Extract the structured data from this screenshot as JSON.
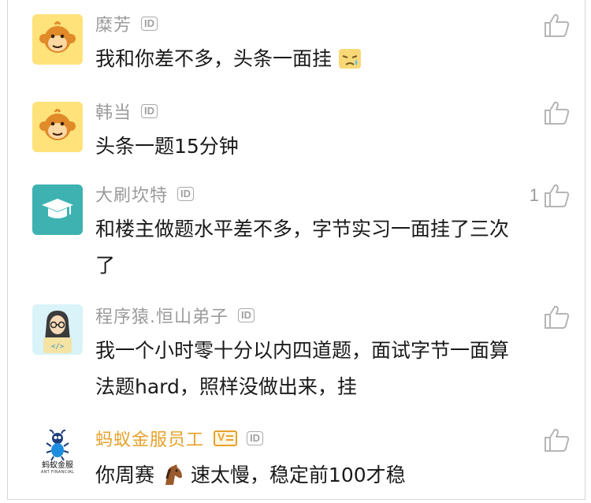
{
  "comments": [
    {
      "name": "糜芳",
      "id_badge": "ID",
      "text": "我和你差不多，头条一面挂",
      "emoji": "emoji-crying-face",
      "likes": "",
      "avatar": "monkey-avatar"
    },
    {
      "name": "韩当",
      "id_badge": "ID",
      "text": "头条一题15分钟",
      "likes": "",
      "avatar": "monkey-avatar"
    },
    {
      "name": "大刷坎特",
      "id_badge": "ID",
      "text": "和楼主做题水平差不多，字节实习一面挂了三次了",
      "likes": "1",
      "avatar": "graduation-cap-avatar"
    },
    {
      "name": "程序猿.恒山弟子",
      "id_badge": "ID",
      "text": "我一个小时零十分以内四道题，面试字节一面算法题hard，照样没做出来，挂",
      "likes": "",
      "avatar": "coder-avatar"
    },
    {
      "name": "蚂蚁金服员工",
      "id_badge": "ID",
      "vip_badge": "V",
      "text_before": "你周赛",
      "emoji": "horse-emoji",
      "text_after": "速太慢，稳定前100才稳",
      "likes": "",
      "avatar": "ant-avatar",
      "avatar_caption": "蚂蚁金服",
      "avatar_caption_sub": "ANT FINANCIAL"
    }
  ],
  "colors": {
    "name_gray": "#9b9b9b",
    "name_gold": "#e6a12a",
    "text": "#1a1a1a",
    "monkey_bg": "#ffe27a",
    "cap_bg": "#3db2b1",
    "coder_bg": "#d9f3f8"
  }
}
